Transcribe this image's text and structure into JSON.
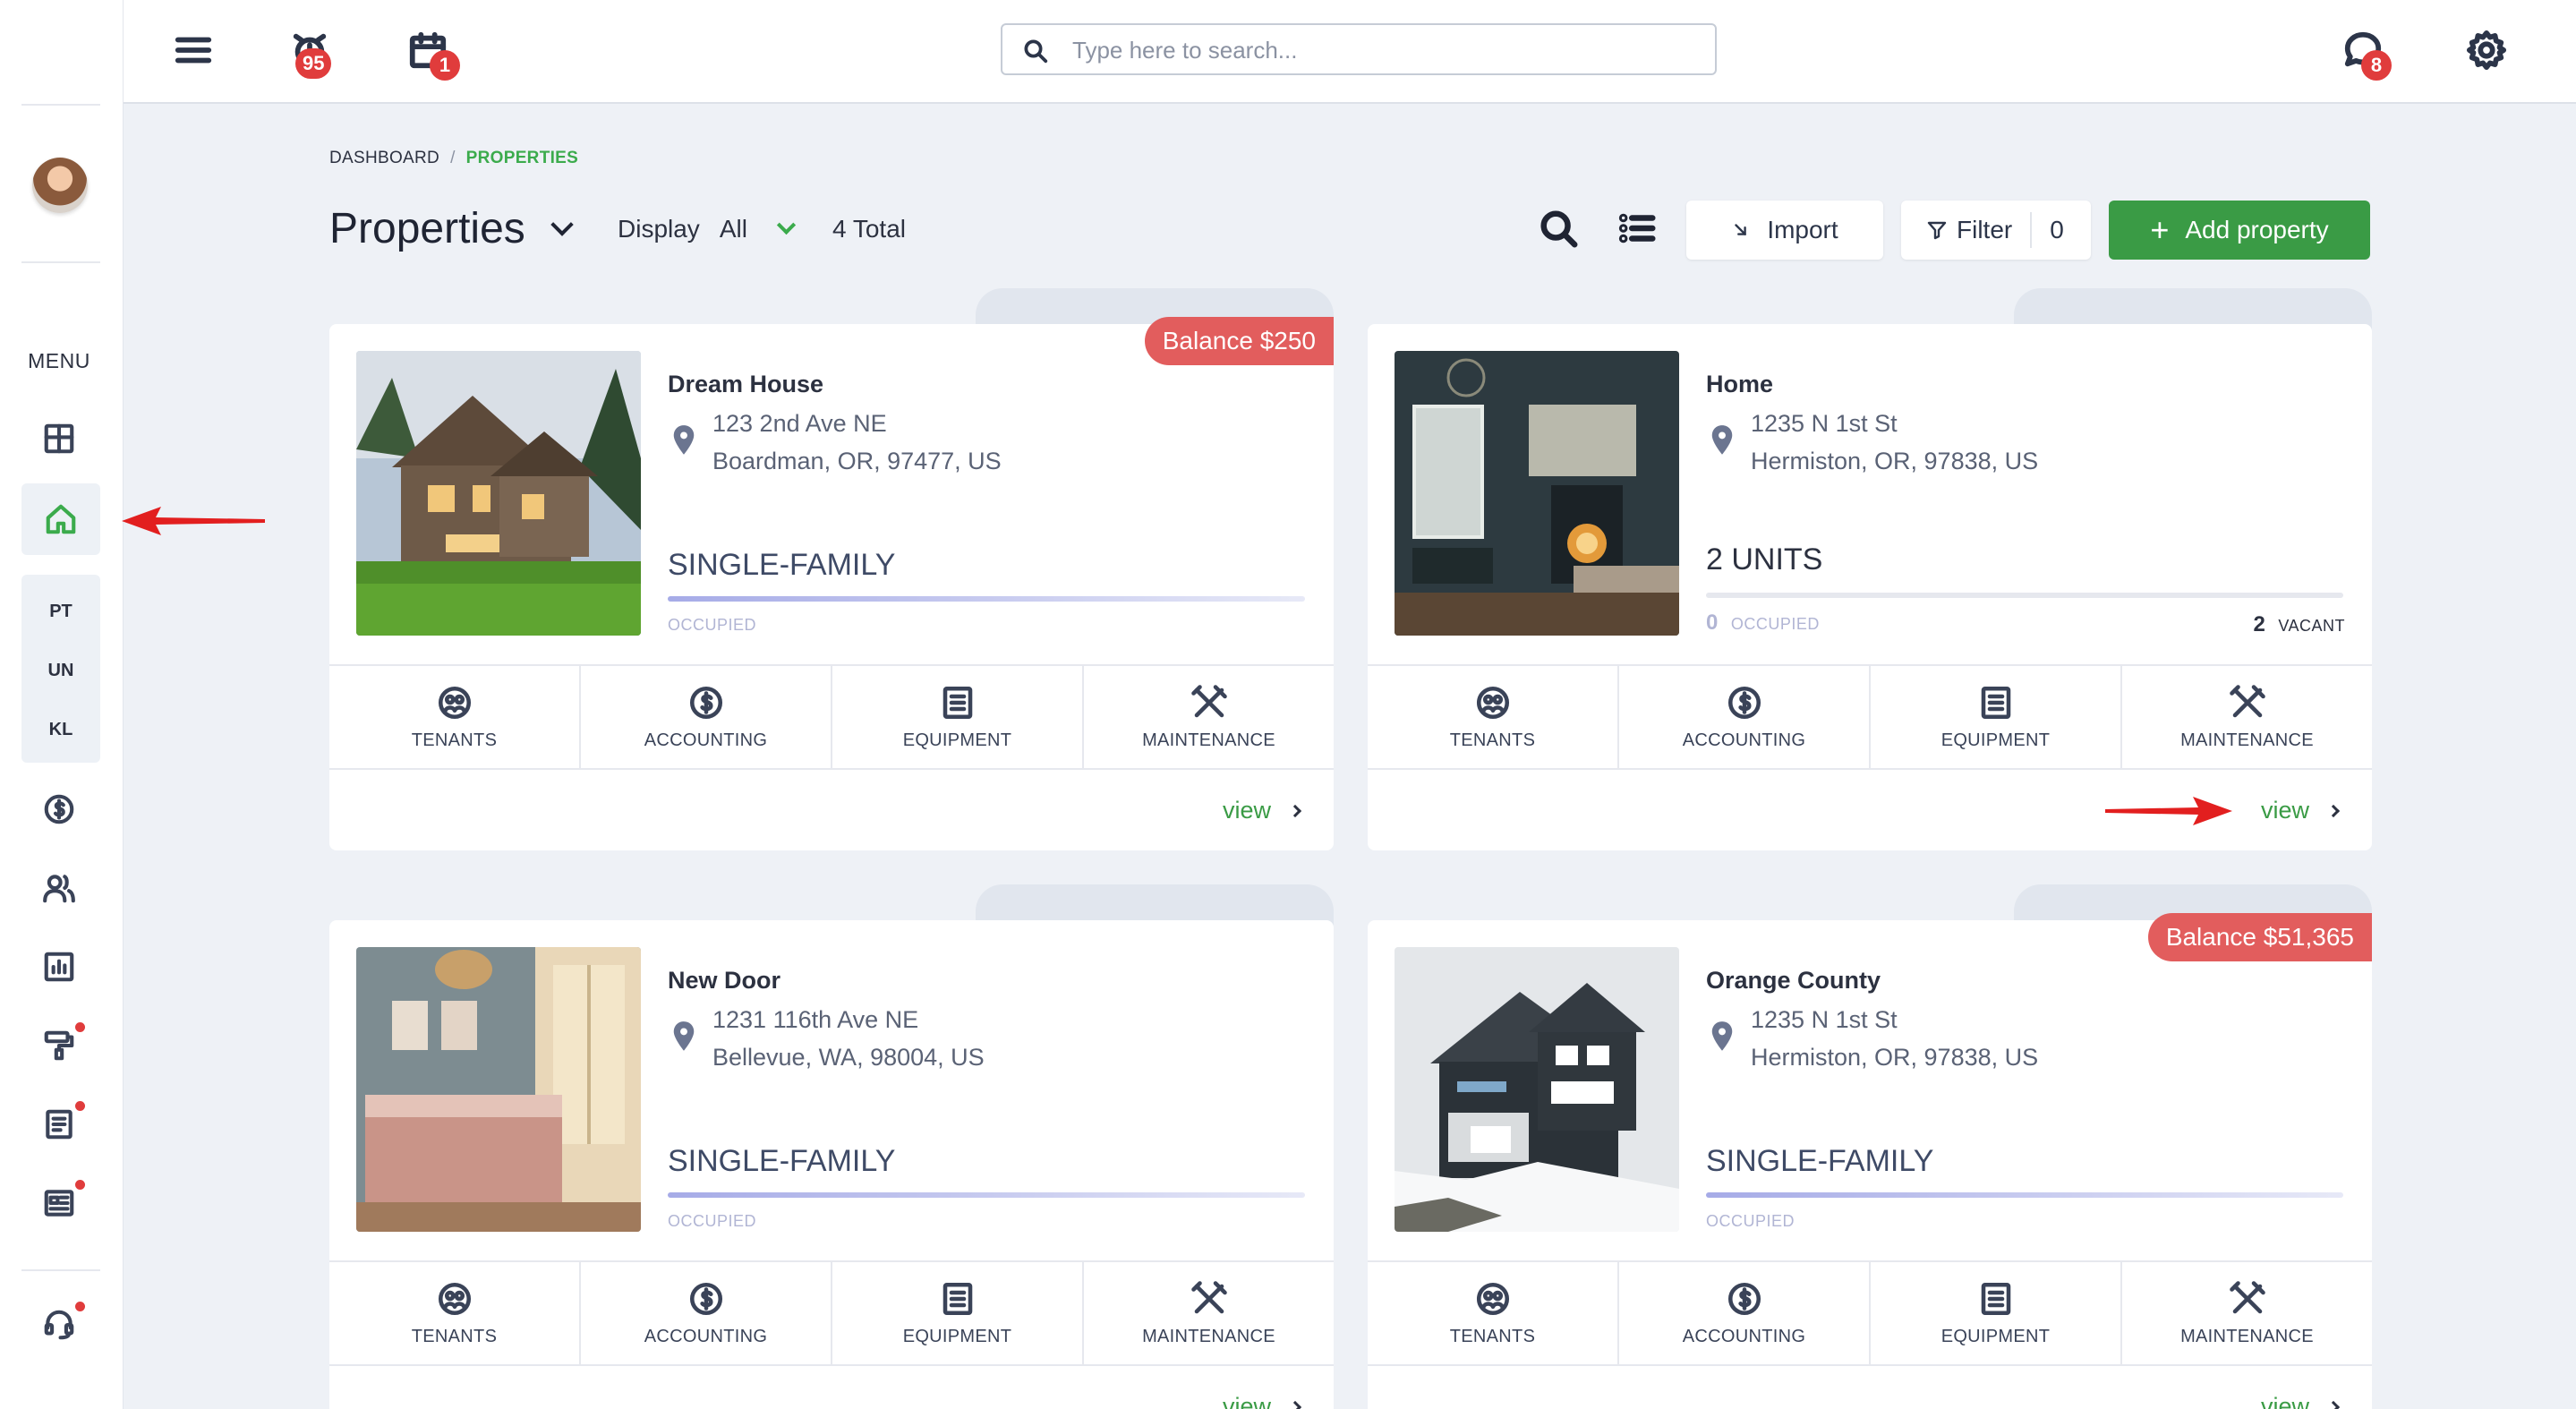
{
  "sidebar": {
    "menu_label": "MENU",
    "sub_items": [
      "PT",
      "UN",
      "KL"
    ],
    "icons": [
      "dashboard-icon",
      "home-icon",
      "dollar-icon",
      "users-icon",
      "reports-icon",
      "paint-roller-icon",
      "document-icon",
      "news-icon",
      "support-icon"
    ]
  },
  "topbar": {
    "alarm_count": "95",
    "calendar_count": "1",
    "chat_count": "8",
    "search_placeholder": "Type here to search..."
  },
  "breadcrumb": {
    "root": "DASHBOARD",
    "separator": "/",
    "current": "PROPERTIES"
  },
  "header": {
    "title": "Properties",
    "display_label": "Display",
    "display_value": "All",
    "total": "4 Total",
    "import_label": "Import",
    "filter_label": "Filter",
    "filter_count": "0",
    "add_label": "Add property"
  },
  "actions_labels": {
    "tenants": "TENANTS",
    "accounting": "ACCOUNTING",
    "equipment": "EQUIPMENT",
    "maintenance": "MAINTENANCE"
  },
  "properties": [
    {
      "name": "Dream House",
      "address_line1": "123 2nd Ave NE",
      "address_line2": "Boardman, OR, 97477, US",
      "type": "SINGLE-FAMILY",
      "status": "OCCUPIED",
      "balance": "Balance $250",
      "view": "view"
    },
    {
      "name": "Home",
      "address_line1": "1235 N 1st St",
      "address_line2": "Hermiston, OR, 97838, US",
      "type": "2 UNITS",
      "occupied_count": "0",
      "occupied_label": "OCCUPIED",
      "vacant_count": "2",
      "vacant_label": "VACANT",
      "view": "view"
    },
    {
      "name": "New Door",
      "address_line1": "1231 116th Ave NE",
      "address_line2": "Bellevue, WA, 98004, US",
      "type": "SINGLE-FAMILY",
      "status": "OCCUPIED",
      "view": "view"
    },
    {
      "name": "Orange County",
      "address_line1": "1235 N 1st St",
      "address_line2": "Hermiston, OR, 97838, US",
      "type": "SINGLE-FAMILY",
      "status": "OCCUPIED",
      "balance": "Balance $51,365",
      "view": "view"
    }
  ],
  "colors": {
    "accent_green": "#3a9b45",
    "balance_red": "#e25d5d",
    "annotation_red": "#e21f1f"
  }
}
